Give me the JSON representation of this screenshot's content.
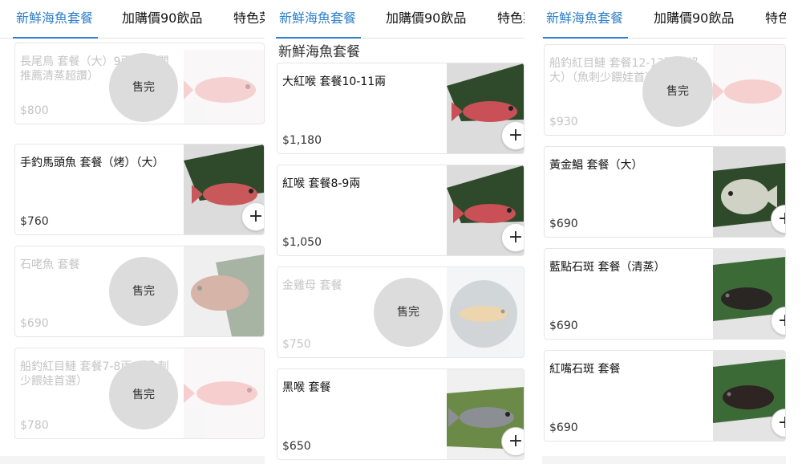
{
  "panels": [
    {
      "tabs": [
        "新鮮海魚套餐",
        "加購價90飲品",
        "特色菜"
      ],
      "items": [
        {
          "name": "長尾鳥 套餐（大）9兩 （老闆推薦清蒸超讚）",
          "price": "$800",
          "sold_out": true,
          "image": "pink-fish"
        },
        {
          "name": "手釣馬頭魚 套餐（烤）（大）",
          "price": "$760",
          "sold_out": false,
          "image": "red-fish-on-leaf"
        },
        {
          "name": "石咾魚 套餐",
          "price": "$690",
          "sold_out": true,
          "image": "brown-fish-on-leaf"
        },
        {
          "name": "船釣紅目鰱 套餐7-8兩 （魚刺少餵娃首選）",
          "price": "$780",
          "sold_out": true,
          "image": "pink-fish"
        }
      ]
    },
    {
      "tabs": [
        "新鮮海魚套餐",
        "加購價90飲品",
        "特色菜"
      ],
      "section_title": "新鮮海魚套餐",
      "items": [
        {
          "name": "大紅喉 套餐10-11兩",
          "price": "$1,180",
          "sold_out": false,
          "image": "red-fish-on-leaf"
        },
        {
          "name": "紅喉 套餐8-9兩",
          "price": "$1,050",
          "sold_out": false,
          "image": "red-fish-on-leaf"
        },
        {
          "name": "金雞母 套餐",
          "price": "$750",
          "sold_out": true,
          "image": "fish-on-ice"
        },
        {
          "name": "黑喉 套餐",
          "price": "$650",
          "sold_out": false,
          "image": "gray-fish-on-leaf"
        }
      ]
    },
    {
      "tabs": [
        "新鮮海魚套餐",
        "加購價90飲品",
        "特色菜"
      ],
      "items": [
        {
          "name": "船釣紅目鰱 套餐12-13兩（超大）（魚刺少餵娃首選）",
          "price": "$930",
          "sold_out": true,
          "image": "pink-fish"
        },
        {
          "name": "黃金鯧 套餐（大）",
          "price": "$690",
          "sold_out": false,
          "image": "silver-pomfret"
        },
        {
          "name": "藍點石斑 套餐（清蒸）",
          "price": "$690",
          "sold_out": false,
          "image": "dark-grouper"
        },
        {
          "name": "紅嘴石斑 套餐",
          "price": "$690",
          "sold_out": false,
          "image": "dark-grouper"
        }
      ]
    }
  ],
  "sold_out_label": "售完",
  "add_symbol": "+",
  "colors": {
    "accent": "#2f80c8",
    "sold_badge": "#dcdcdc",
    "divider": "#e3e3e3"
  }
}
